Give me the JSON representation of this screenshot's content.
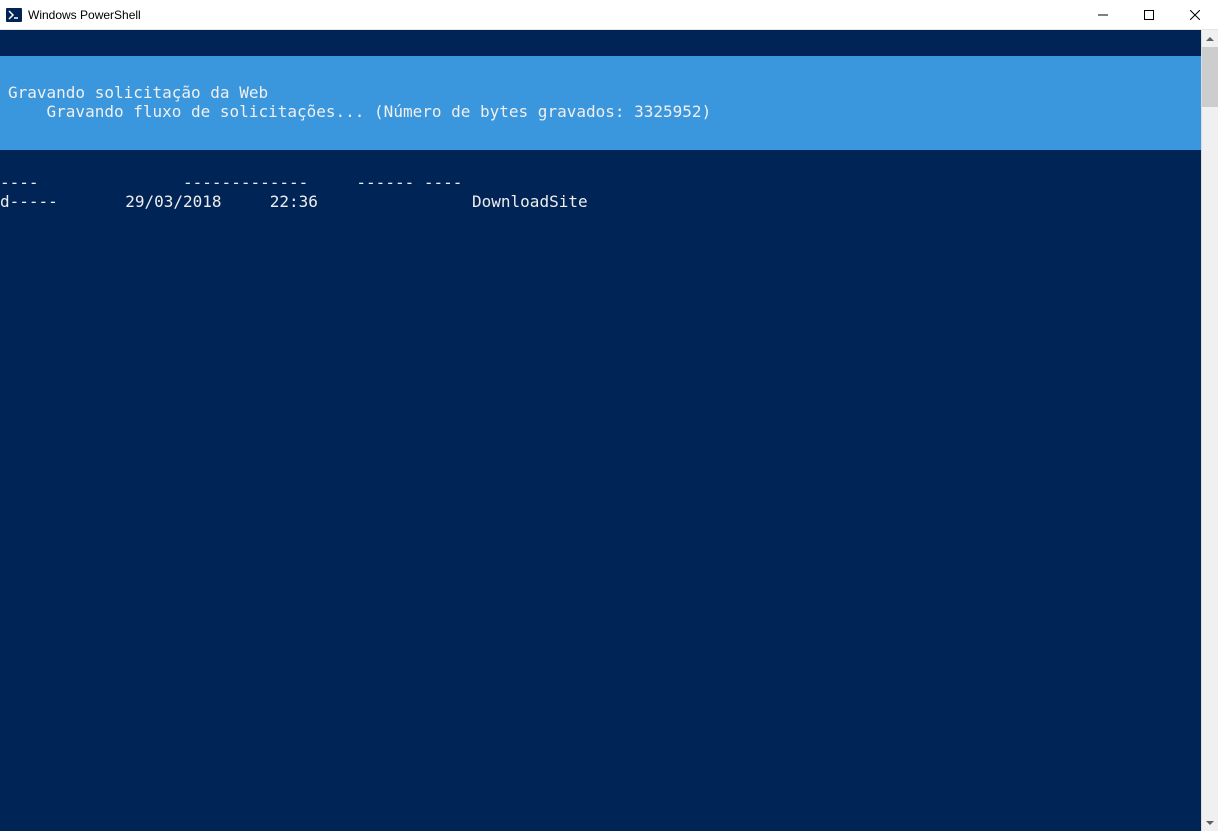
{
  "window": {
    "title": "Windows PowerShell"
  },
  "progress": {
    "line1": "Gravando solicitação da Web",
    "line2": "    Gravando fluxo de solicitações... (Número de bytes gravados: 3325952)"
  },
  "listing": {
    "dashes": "----               -------------     ------ ----",
    "entry": "d-----       29/03/2018     22:36                DownloadSite"
  }
}
